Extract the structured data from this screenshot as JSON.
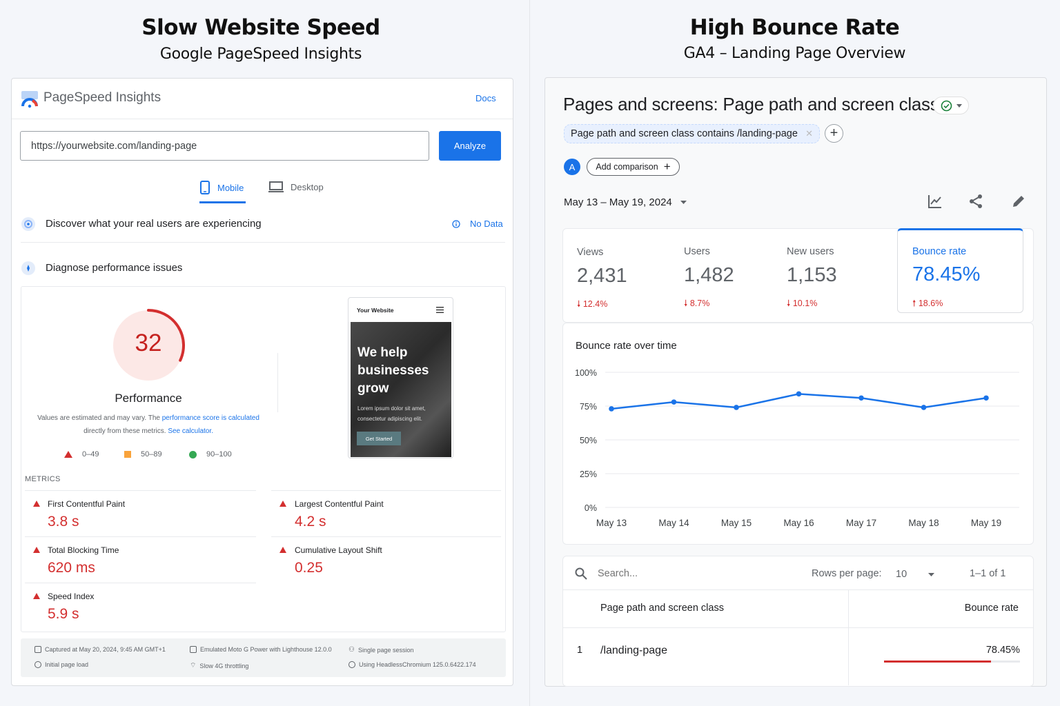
{
  "left_header": {
    "title": "Slow Website Speed",
    "subtitle": "Google PageSpeed Insights"
  },
  "right_header": {
    "title": "High Bounce Rate",
    "subtitle": "GA4 – Landing Page Overview"
  },
  "psi": {
    "app_name": "PageSpeed Insights",
    "docs_link": "Docs",
    "url_value": "https://yourwebsite.com/landing-page",
    "analyze_label": "Analyze",
    "tabs": [
      {
        "label": "Mobile",
        "active": true
      },
      {
        "label": "Desktop",
        "active": false
      }
    ],
    "real_users_title": "Discover what your real users are experiencing",
    "no_data_label": "No Data",
    "diagnose_title": "Diagnose performance issues",
    "score": 32,
    "score_label": "Performance",
    "note_prefix": "Values are estimated and may vary. The ",
    "note_link1": "performance score is calculated",
    "note_middle": "directly from these metrics. ",
    "note_link2": "See calculator.",
    "legend": [
      {
        "range": "0–49",
        "color": "#d32f2f"
      },
      {
        "range": "50–89",
        "color": "#f9a33b"
      },
      {
        "range": "90–100",
        "color": "#34a853"
      }
    ],
    "metrics_heading": "METRICS",
    "metrics": [
      {
        "label": "First Contentful Paint",
        "value": "3.8 s"
      },
      {
        "label": "Largest Contentful Paint",
        "value": "4.2 s"
      },
      {
        "label": "Total Blocking Time",
        "value": "620 ms"
      },
      {
        "label": "Cumulative Layout Shift",
        "value": "0.25"
      },
      {
        "label": "Speed Index",
        "value": "5.9 s"
      }
    ],
    "phone": {
      "site_name": "Your Website",
      "headline": "We help businesses grow",
      "body": "Lorem ipsum dolor sit amet, consectetur adipiscing elit.",
      "button": "Get Started"
    },
    "footer": {
      "captured": "Captured at May 20, 2024, 9:45 AM GMT+1",
      "initial_load": "Initial page load",
      "device": "Emulated Moto G Power with Lighthouse 12.0.0",
      "throttling": "Slow 4G throttling",
      "session": "Single page session",
      "browser": "Using HeadlessChromium 125.0.6422.174"
    }
  },
  "ga4": {
    "report_title": "Pages and screens: Page path and screen class",
    "filter_chip": "Page path and screen class contains /landing-page",
    "avatar_letter": "A",
    "add_comparison": "Add comparison",
    "date_range": "May 13 – May 19, 2024",
    "kpis": [
      {
        "label": "Views",
        "value": "2,431",
        "delta": "12.4%",
        "direction": "down"
      },
      {
        "label": "Users",
        "value": "1,482",
        "delta": "8.7%",
        "direction": "down"
      },
      {
        "label": "New users",
        "value": "1,153",
        "delta": "10.1%",
        "direction": "down"
      },
      {
        "label": "Bounce rate",
        "value": "78.45%",
        "delta": "18.6%",
        "direction": "up",
        "selected": true
      }
    ],
    "chart_title": "Bounce rate over time",
    "search_placeholder": "Search...",
    "rows_per_page_label": "Rows per page:",
    "rows_per_page_value": "10",
    "pagination": "1–1 of 1",
    "table": {
      "columns": [
        "Page path and screen class",
        "Bounce rate"
      ],
      "rows": [
        {
          "index": "1",
          "path": "/landing-page",
          "bounce_rate": "78.45%",
          "fraction": 0.7845
        }
      ]
    }
  },
  "chart_data": {
    "type": "line",
    "title": "Bounce rate over time",
    "x": [
      "May 13",
      "May 14",
      "May 15",
      "May 16",
      "May 17",
      "May 18",
      "May 19"
    ],
    "series": [
      {
        "values": [
          73,
          78,
          74,
          84,
          81,
          74,
          81
        ]
      }
    ],
    "y_ticks": [
      "100%",
      "75%",
      "50%",
      "25%",
      "0%"
    ],
    "ylim": [
      0,
      100
    ],
    "color": "#1a73e8",
    "grid": true
  }
}
